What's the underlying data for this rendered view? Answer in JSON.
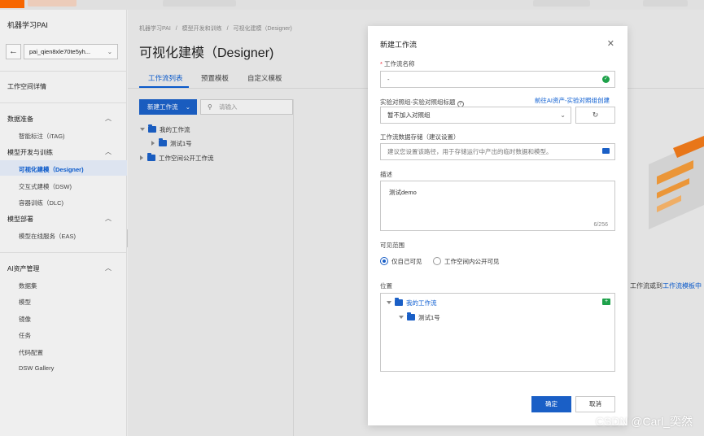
{
  "sidebar": {
    "title": "机器学习PAI",
    "workspace": "pai_qien8xle70te5yh...",
    "workspace_detail": "工作空间详情",
    "groups": [
      {
        "label": "数据准备",
        "items": [
          "智能标注（iTAG)"
        ]
      },
      {
        "label": "模型开发与训练",
        "items": [
          "可视化建模（Designer)",
          "交互式建模（DSW)",
          "容器训练（DLC)"
        ]
      },
      {
        "label": "模型部署",
        "items": [
          "模型在线服务（EAS)"
        ]
      },
      {
        "label": "AI资产管理",
        "items": [
          "数据集",
          "模型",
          "镜像",
          "任务",
          "代码配置",
          "DSW Gallery"
        ]
      }
    ]
  },
  "main": {
    "breadcrumb": [
      "机器学习PAI",
      "/",
      "模型开发和训练",
      "/",
      "可视化建模（Designer)"
    ],
    "title": "可视化建模（Designer)",
    "tabs": [
      "工作流列表",
      "预置模板",
      "自定义模板"
    ],
    "new_button": "新建工作流",
    "search_placeholder": "请输入",
    "tree": [
      "我的工作流",
      "测试1号",
      "工作空间公开工作流"
    ],
    "bg_text_a": "工作流或到",
    "bg_text_link": "工作流模板中"
  },
  "modal": {
    "title": "新建工作流",
    "name_label": "工作流名称",
    "name_value": "-",
    "group_label": "实验对照组-实验对照组标题",
    "group_link": "前往AI资产-实验对照组创建",
    "group_value": "暂不加入对照组",
    "storage_label": "工作流数据存储（建议设置）",
    "storage_placeholder": "建议您设置该路径，用于存储运行中产出的临时数据和模型。",
    "desc_label": "描述",
    "desc_value": "测试demo",
    "desc_count": "6/256",
    "visibility_label": "可见范围",
    "visibility_options": [
      "仅自己可见",
      "工作空间内公开可见"
    ],
    "visibility_selected": "仅自己可见",
    "location_label": "位置",
    "location_tree": [
      "我的工作流",
      "测试1号"
    ],
    "ok_label": "确定",
    "cancel_label": "取消"
  },
  "watermark": "CSDN @Carl_奕然",
  "colors": {
    "primary": "#1a5fc6",
    "success": "#1ea14a",
    "brand": "#ff6a00"
  }
}
